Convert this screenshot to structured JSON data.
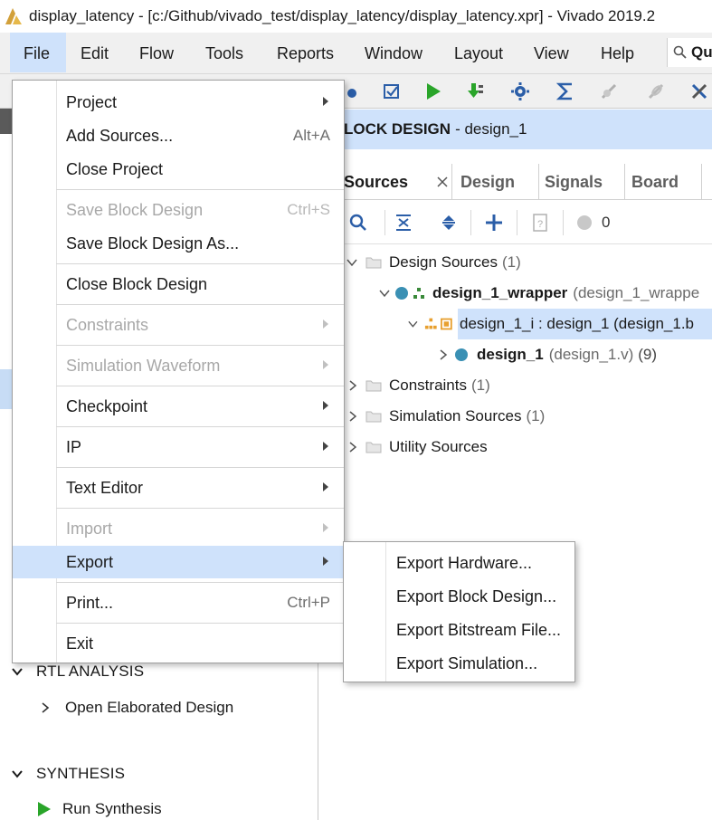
{
  "window": {
    "title": "display_latency - [c:/Github/vivado_test/display_latency/display_latency.xpr] - Vivado 2019.2"
  },
  "menubar": {
    "items": [
      {
        "label": "File"
      },
      {
        "label": "Edit"
      },
      {
        "label": "Flow"
      },
      {
        "label": "Tools"
      },
      {
        "label": "Reports"
      },
      {
        "label": "Window"
      },
      {
        "label": "Layout"
      },
      {
        "label": "View"
      },
      {
        "label": "Help"
      }
    ],
    "quick_access": "Qu"
  },
  "file_menu": {
    "items": [
      {
        "label": "Project",
        "submenu": true,
        "enabled": true
      },
      {
        "label": "Add Sources...",
        "shortcut": "Alt+A",
        "enabled": true
      },
      {
        "label": "Close Project",
        "enabled": true
      },
      {
        "label": "Save Block Design",
        "shortcut": "Ctrl+S",
        "enabled": false
      },
      {
        "label": "Save Block Design As...",
        "enabled": true
      },
      {
        "label": "Close Block Design",
        "enabled": true
      },
      {
        "label": "Constraints",
        "submenu": true,
        "enabled": false
      },
      {
        "label": "Simulation Waveform",
        "submenu": true,
        "enabled": false
      },
      {
        "label": "Checkpoint",
        "submenu": true,
        "enabled": true
      },
      {
        "label": "IP",
        "submenu": true,
        "enabled": true
      },
      {
        "label": "Text Editor",
        "submenu": true,
        "enabled": true
      },
      {
        "label": "Import",
        "submenu": true,
        "enabled": false
      },
      {
        "label": "Export",
        "submenu": true,
        "enabled": true,
        "highlighted": true
      },
      {
        "label": "Print...",
        "shortcut": "Ctrl+P",
        "enabled": true
      },
      {
        "label": "Exit",
        "enabled": true
      }
    ]
  },
  "export_menu": {
    "items": [
      {
        "label": "Export Hardware..."
      },
      {
        "label": "Export Block Design..."
      },
      {
        "label": "Export Bitstream File..."
      },
      {
        "label": "Export Simulation..."
      }
    ]
  },
  "block_design": {
    "title": "LOCK DESIGN",
    "name": "- design_1"
  },
  "tabs": [
    {
      "label": "Sources"
    },
    {
      "label": "Design"
    },
    {
      "label": "Signals"
    },
    {
      "label": "Board"
    }
  ],
  "sources_toolbar": {
    "count": "0"
  },
  "sources_tree": {
    "design_sources": {
      "label": "Design Sources",
      "count": "(1)"
    },
    "wrapper": {
      "label": "design_1_wrapper",
      "detail": "(design_1_wrappe"
    },
    "instance": {
      "label": "design_1_i : design_1 (design_1.b"
    },
    "design": {
      "label": "design_1",
      "detail": "(design_1.v)",
      "count": "(9)"
    },
    "constraints": {
      "label": "Constraints",
      "count": "(1)"
    },
    "simulation": {
      "label": "Simulation Sources",
      "count": "(1)"
    },
    "utility": {
      "label": "Utility Sources"
    }
  },
  "flow_navigator": {
    "rtl_analysis": "RTL ANALYSIS",
    "open_elaborated": "Open Elaborated Design",
    "synthesis": "SYNTHESIS",
    "run_synthesis": "Run Synthesis"
  },
  "colors": {
    "menu_highlight": "#cfe2fb",
    "run_green": "#2aa52a",
    "toolbar_blue": "#2b5ea8"
  }
}
